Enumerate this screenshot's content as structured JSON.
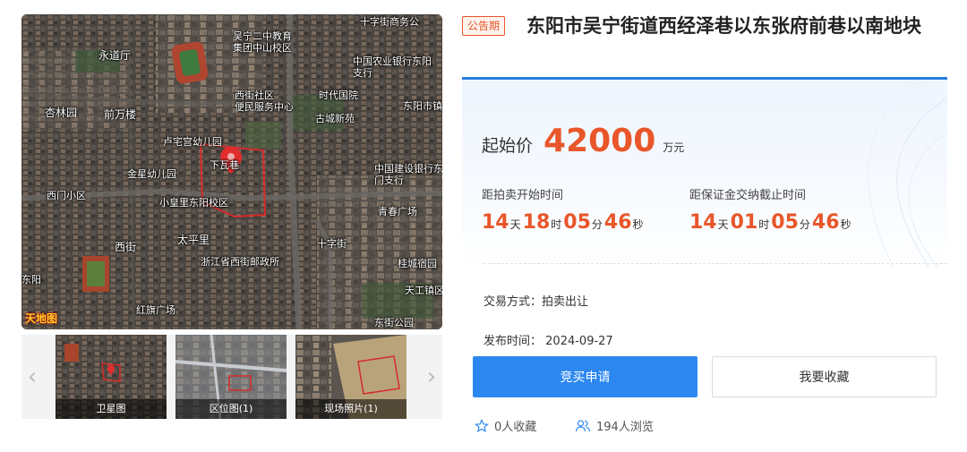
{
  "gallery": {
    "map_labels": [
      {
        "name": "map-label-school",
        "text": "吴宁二中教育\n集团中山校区"
      },
      {
        "name": "map-label-shizi",
        "text": "十字街商务公"
      },
      {
        "name": "map-label-yongdaoting",
        "text": "永道厅"
      },
      {
        "name": "map-label-nongye",
        "text": "中国农业银行东阳\n支行"
      },
      {
        "name": "map-label-xijie",
        "text": "西街社区\n便民服务中心"
      },
      {
        "name": "map-label-shidai",
        "text": "时代国院"
      },
      {
        "name": "map-label-gudu",
        "text": "古城新苑"
      },
      {
        "name": "map-label-dongyang",
        "text": "东阳市镇"
      },
      {
        "name": "map-label-xingyuan",
        "text": "杏林园"
      },
      {
        "name": "map-label-qianwan",
        "text": "前万楼"
      },
      {
        "name": "map-label-lugong",
        "text": "卢宅宫幼儿园"
      },
      {
        "name": "map-label-jinxing",
        "text": "金星幼儿园"
      },
      {
        "name": "map-label-xiawaxiang",
        "text": "下瓦巷"
      },
      {
        "name": "map-label-jianshe",
        "text": "中国建设银行东阳\n门支行"
      },
      {
        "name": "map-label-ximen",
        "text": "西门小区"
      },
      {
        "name": "map-label-xiaohuangli",
        "text": "小皇里东阳校区"
      },
      {
        "name": "map-label-qingchun",
        "text": "青春广场"
      },
      {
        "name": "map-label-taiping",
        "text": "太平里"
      },
      {
        "name": "map-label-xijie-road",
        "text": "西街"
      },
      {
        "name": "map-label-zheng",
        "text": "浙江省西街邮政所"
      },
      {
        "name": "map-label-shizijie",
        "text": "十字街"
      },
      {
        "name": "map-label-dongyangxi",
        "text": "东阳"
      },
      {
        "name": "map-label-hongqi",
        "text": "红旗广场"
      },
      {
        "name": "map-label-dongjie",
        "text": "东街公园"
      },
      {
        "name": "map-label-guanyun",
        "text": "桂城宿园"
      },
      {
        "name": "map-label-tiangong",
        "text": "天工镇区"
      }
    ],
    "logo_text": "天地图",
    "thumbnails": [
      {
        "caption": "卫星图"
      },
      {
        "caption": "区位图(1)"
      },
      {
        "caption": "现场照片(1)"
      }
    ]
  },
  "lot": {
    "status": "公告期",
    "title": "东阳市吴宁街道西经泽巷以东张府前巷以南地块",
    "price_label": "起始价",
    "price_value": "42000",
    "price_unit": "万元",
    "auction_start": {
      "label": "距拍卖开始时间",
      "days": "14",
      "days_unit": "天",
      "hours": "18",
      "hours_unit": "时",
      "minutes": "05",
      "minutes_unit": "分",
      "seconds": "46",
      "seconds_unit": "秒"
    },
    "deposit_deadline": {
      "label": "距保证金交纳截止时间",
      "days": "14",
      "days_unit": "天",
      "hours": "01",
      "hours_unit": "时",
      "minutes": "05",
      "minutes_unit": "分",
      "seconds": "46",
      "seconds_unit": "秒"
    },
    "trade_mode": "交易方式：拍卖出让",
    "publish_label": "发布时间：",
    "publish_date": "2024-09-27"
  },
  "actions": {
    "bid_button": "竞买申请",
    "favorite_button": "我要收藏"
  },
  "stats": {
    "favorites": "0人收藏",
    "views": "194人浏览"
  },
  "colors": {
    "accent_orange": "#e8562a",
    "primary_blue": "#2c88f0",
    "divider_blue": "#2a7de1"
  }
}
